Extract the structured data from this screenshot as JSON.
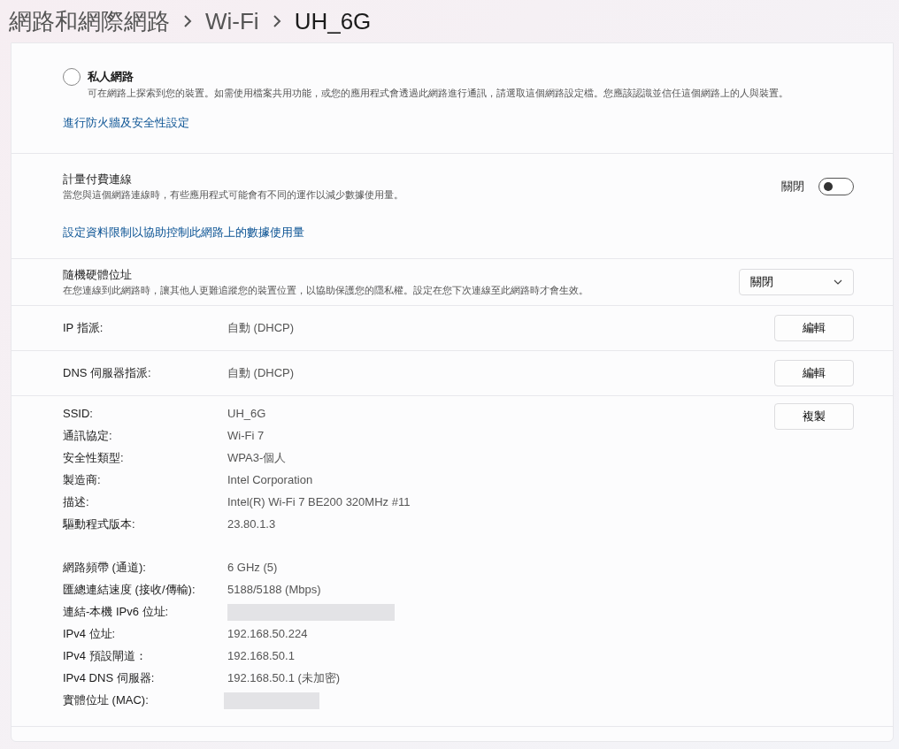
{
  "breadcrumb": [
    "網路和網際網路",
    "Wi-Fi",
    "UH_6G"
  ],
  "network_profile": {
    "options": [
      {
        "label": "私人網路",
        "description": "可在網路上探索到您的裝置。如需使用檔案共用功能，或您的應用程式會透過此網路進行通訊，請選取這個網路設定檔。您應該認識並信任這個網路上的人與裝置。",
        "selected": false
      }
    ],
    "link": "進行防火牆及安全性設定"
  },
  "metered": {
    "title": "計量付費連線",
    "description": "當您與這個網路連線時，有些應用程式可能會有不同的運作以減少數據使用量。",
    "toggle_label": "關閉",
    "on": false,
    "link": "設定資料限制以協助控制此網路上的數據使用量"
  },
  "random_hardware_address": {
    "title": "隨機硬體位址",
    "description": "在您連線到此網路時，讓其他人更難追蹤您的裝置位置，以協助保護您的隱私權。設定在您下次連線至此網路時才會生效。",
    "dropdown_value": "關閉"
  },
  "assignments": [
    {
      "label": "IP 指派:",
      "value": "自動 (DHCP)",
      "button": "編輯"
    },
    {
      "label": "DNS 伺服器指派:",
      "value": "自動 (DHCP)",
      "button": "編輯"
    }
  ],
  "properties": {
    "button": "複製",
    "groups": [
      [
        {
          "label": "SSID:",
          "kind": "text",
          "value": "UH_6G"
        },
        {
          "label": "通訊協定:",
          "kind": "text",
          "value": "Wi-Fi 7"
        },
        {
          "label": "安全性類型:",
          "kind": "text",
          "value": "WPA3-個人"
        },
        {
          "label": "製造商:",
          "kind": "text",
          "value": "Intel Corporation"
        },
        {
          "label": "描述:",
          "kind": "text",
          "value": "Intel(R) Wi-Fi 7 BE200 320MHz #11"
        },
        {
          "label": "驅動程式版本:",
          "kind": "text",
          "value": "23.80.1.3"
        }
      ],
      [
        {
          "label": "網路頻帶 (通道):",
          "kind": "text",
          "value": "6 GHz (5)"
        },
        {
          "label": "匯總連結速度 (接收/傳輸):",
          "kind": "text",
          "value": "5188/5188 (Mbps)"
        },
        {
          "label": "連結-本機 IPv6 位址:",
          "kind": "redacted"
        },
        {
          "label": "IPv4 位址:",
          "kind": "text",
          "value": "192.168.50.224"
        },
        {
          "label": "IPv4 預設閘道：",
          "kind": "text",
          "value": "192.168.50.1"
        },
        {
          "label": "IPv4 DNS 伺服器:",
          "kind": "text",
          "value": "192.168.50.1 (未加密)"
        },
        {
          "label": "實體位址 (MAC):",
          "kind": "redacted",
          "short": true
        }
      ]
    ]
  }
}
